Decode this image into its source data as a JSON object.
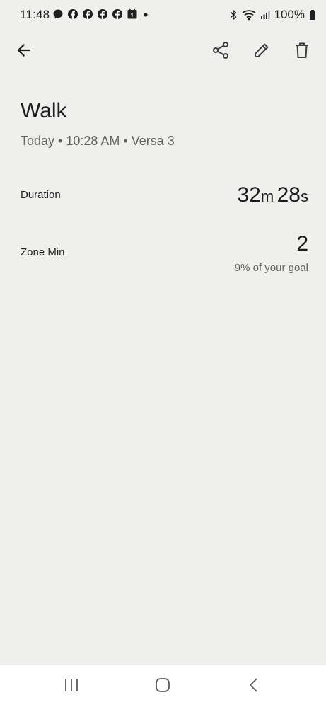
{
  "status_bar": {
    "time": "11:48",
    "battery": "100%",
    "notification_icons": [
      "messenger-icon",
      "facebook-icon",
      "facebook-icon",
      "facebook-icon",
      "facebook-icon",
      "calendar-icon",
      "dot-icon"
    ],
    "system_icons": [
      "bluetooth-icon",
      "wifi-icon",
      "signal-icon",
      "battery-icon"
    ]
  },
  "app_bar": {
    "icons": [
      "back-arrow-icon",
      "share-icon",
      "edit-icon",
      "delete-icon"
    ]
  },
  "activity": {
    "title": "Walk",
    "subtitle": "Today • 10:28 AM • Versa 3"
  },
  "stats": {
    "duration": {
      "label": "Duration",
      "minutes": "32",
      "minutes_unit": "m",
      "seconds": "28",
      "seconds_unit": "s"
    },
    "zone_min": {
      "label": "Zone Min",
      "value": "2",
      "goal_text": "9% of your goal"
    }
  },
  "nav_bar": {
    "icons": [
      "recent-apps-icon",
      "home-icon",
      "back-icon"
    ]
  }
}
